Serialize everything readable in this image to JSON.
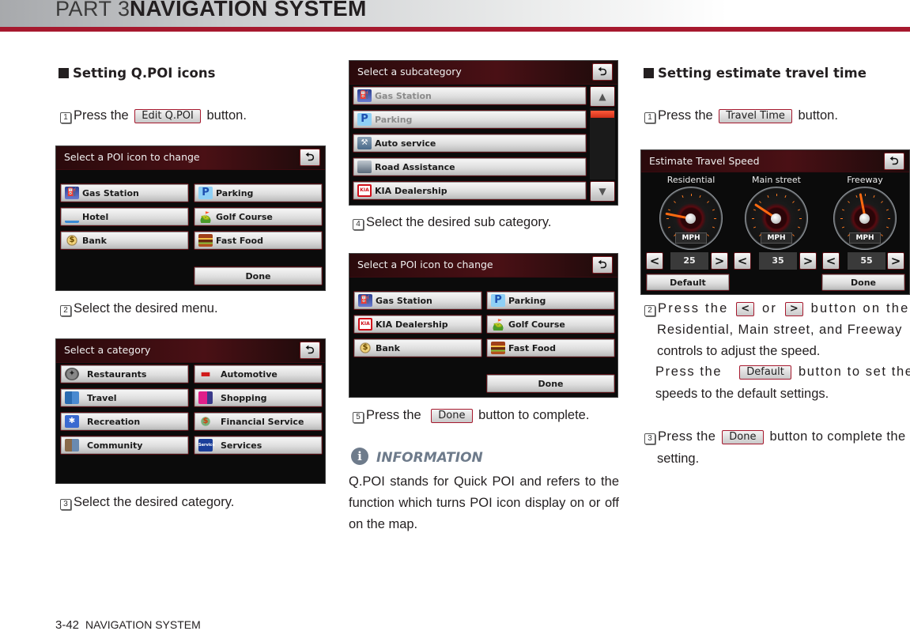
{
  "header": {
    "part": "PART 3",
    "title": "NAVIGATION SYSTEM"
  },
  "footer": {
    "page_number": "3-42",
    "section": "NAVIGATION SYSTEM"
  },
  "left_column": {
    "heading": "Setting Q.POI icons",
    "step1": {
      "num": "1",
      "before": "Press the",
      "button": "Edit Q.POI",
      "after": "button."
    },
    "screen1": {
      "title": "Select a POI icon to change",
      "back_icon": "⮌",
      "items": [
        {
          "label": "Gas Station",
          "icon": "gas-station-icon",
          "glyph": "⛽"
        },
        {
          "label": "Parking",
          "icon": "parking-icon",
          "glyph": "P"
        },
        {
          "label": "Hotel",
          "icon": "hotel-icon",
          "glyph": ""
        },
        {
          "label": "Golf Course",
          "icon": "golf-course-icon",
          "glyph": "⛳"
        },
        {
          "label": "Bank",
          "icon": "bank-icon",
          "glyph": "$"
        },
        {
          "label": "Fast Food",
          "icon": "fast-food-icon",
          "glyph": ""
        }
      ],
      "done": "Done"
    },
    "step2": {
      "num": "2",
      "text": "Select the desired menu."
    },
    "screen2": {
      "title": "Select a category",
      "back_icon": "⮌",
      "items": [
        {
          "label": "Restaurants",
          "icon": "restaurants-icon",
          "glyph": "✦"
        },
        {
          "label": "Automotive",
          "icon": "automotive-icon",
          "glyph": "▬"
        },
        {
          "label": "Travel",
          "icon": "travel-icon",
          "glyph": ""
        },
        {
          "label": "Shopping",
          "icon": "shopping-icon",
          "glyph": ""
        },
        {
          "label": "Recreation",
          "icon": "recreation-icon",
          "glyph": "✱"
        },
        {
          "label": "Financial Service",
          "icon": "financial-service-icon",
          "glyph": "$"
        },
        {
          "label": "Community",
          "icon": "community-icon",
          "glyph": ""
        },
        {
          "label": "Services",
          "icon": "services-icon",
          "glyph": "Service"
        }
      ]
    },
    "step3": {
      "num": "3",
      "text": "Select the desired category."
    }
  },
  "middle_column": {
    "screen3": {
      "title": "Select a subcategory",
      "back_icon": "⮌",
      "items": [
        {
          "label": "Gas Station",
          "icon": "gas-station-icon",
          "glyph": "⛽",
          "dimmed": true
        },
        {
          "label": "Parking",
          "icon": "parking-icon",
          "glyph": "P",
          "dimmed": true
        },
        {
          "label": "Auto service",
          "icon": "auto-service-icon",
          "glyph": "⚒",
          "dimmed": false
        },
        {
          "label": "Road Assistance",
          "icon": "road-assistance-icon",
          "glyph": "",
          "dimmed": false
        },
        {
          "label": "KIA Dealership",
          "icon": "kia-icon",
          "glyph": "KIA",
          "dimmed": false
        }
      ],
      "scroll_up": "▲",
      "scroll_down": "▼",
      "scroll_position": 0.0
    },
    "step4": {
      "num": "4",
      "text": "Select the desired sub category."
    },
    "screen4": {
      "title": "Select a POI icon to change",
      "back_icon": "⮌",
      "items": [
        {
          "label": "Gas Station",
          "icon": "gas-station-icon",
          "glyph": "⛽"
        },
        {
          "label": "Parking",
          "icon": "parking-icon",
          "glyph": "P"
        },
        {
          "label": "KIA Dealership",
          "icon": "kia-icon",
          "glyph": "KIA"
        },
        {
          "label": "Golf Course",
          "icon": "golf-course-icon",
          "glyph": "⛳"
        },
        {
          "label": "Bank",
          "icon": "bank-icon",
          "glyph": "$"
        },
        {
          "label": "Fast Food",
          "icon": "fast-food-icon",
          "glyph": ""
        }
      ],
      "done": "Done"
    },
    "step5": {
      "num": "5",
      "before": "Press the",
      "button": "Done",
      "after": "button to complete."
    },
    "information": {
      "icon": "i",
      "title": "INFORMATION",
      "body": "Q.POI stands for Quick POI and refers to the function which turns POI icon display on or off on the map."
    }
  },
  "right_column": {
    "heading": "Setting estimate travel time",
    "step1": {
      "num": "1",
      "before": "Press the",
      "button": "Travel Time",
      "after": "button."
    },
    "screen5": {
      "title": "Estimate Travel Speed",
      "back_icon": "⮌",
      "gauges": [
        {
          "label": "Residential",
          "value": "25",
          "speed": 25,
          "unit": "MPH"
        },
        {
          "label": "Main street",
          "value": "35",
          "speed": 35,
          "unit": "MPH"
        },
        {
          "label": "Freeway",
          "value": "55",
          "speed": 55,
          "unit": "MPH"
        }
      ],
      "gauge_max": 120,
      "decrease": "<",
      "increase": ">",
      "default": "Default",
      "done": "Done"
    },
    "step2": {
      "num": "2",
      "before": "Press the",
      "left_btn": "<",
      "mid": "or",
      "right_btn": ">",
      "after": "button on the",
      "line2": "Residential, Main street, and Freeway",
      "line3": "controls to adjust the speed.",
      "line4_before": "Press the",
      "line4_button": "Default",
      "line4_after": "button to set the",
      "line5": "speeds to the default settings."
    },
    "step3": {
      "num": "3",
      "before": "Press the",
      "button": "Done",
      "after": "button to complete the",
      "line2": "setting."
    }
  }
}
